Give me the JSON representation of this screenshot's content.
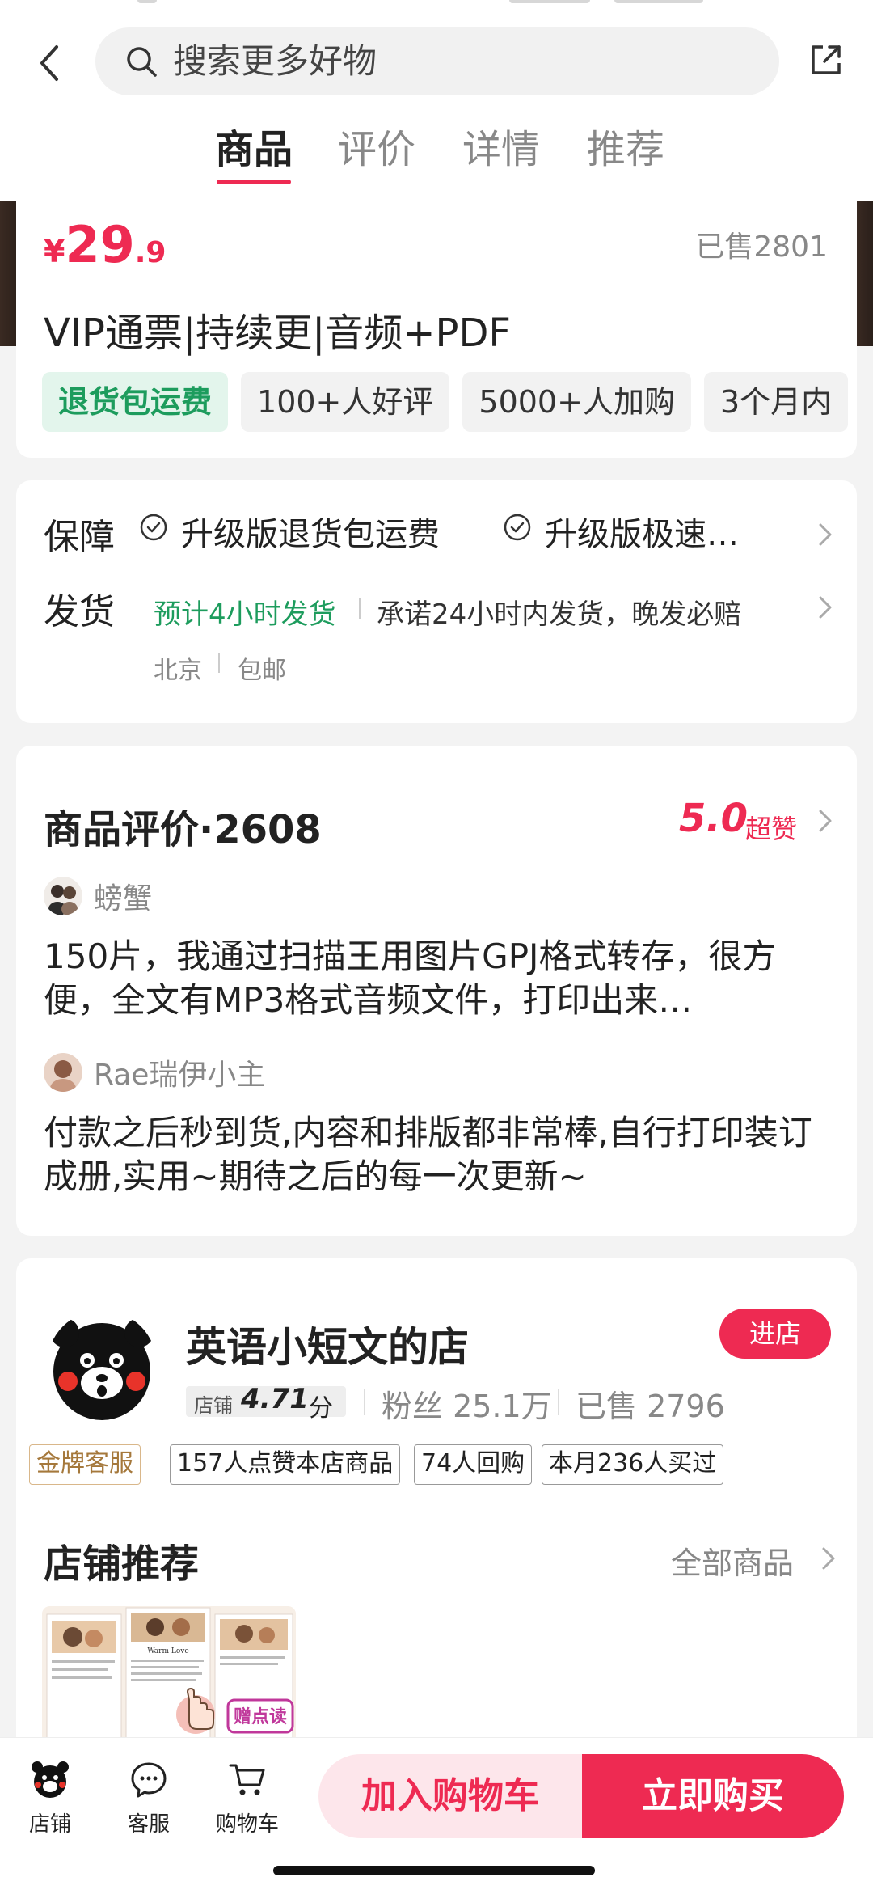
{
  "search": {
    "placeholder": "搜索更多好物"
  },
  "tabs": [
    {
      "label": "商品",
      "active": true
    },
    {
      "label": "评价",
      "active": false
    },
    {
      "label": "详情",
      "active": false
    },
    {
      "label": "推荐",
      "active": false
    }
  ],
  "product": {
    "currency": "¥",
    "price_int": "29",
    "price_dec": ".9",
    "sold": "已售2801",
    "title": "VIP通票|持续更|音频+PDF",
    "tags": [
      "退货包运费",
      "100+人好评",
      "5000+人加购",
      "3个月内"
    ]
  },
  "guarantee": {
    "label": "保障",
    "items": [
      "升级版退货包运费",
      "升级版极速…"
    ]
  },
  "shipping": {
    "label": "发货",
    "estimate": "预计4小时发货",
    "promise": "承诺24小时内发货，晚发必赔",
    "origin": "北京",
    "postage": "包邮"
  },
  "reviews": {
    "title": "商品评价·2608",
    "score": "5.0",
    "score_label": "超赞",
    "items": [
      {
        "user": "螃蟹",
        "text": "150片，我通过扫描王用图片GPJ格式转存，很方便，全文有MP3格式音频文件，打印出来…"
      },
      {
        "user": "Rae瑞伊小主",
        "text": "付款之后秒到货,内容和排版都非常棒,自行打印装订成册,实用~期待之后的每一次更新~"
      }
    ]
  },
  "shop": {
    "name": "英语小短文的店",
    "enter_label": "进店",
    "rating_label": "店铺",
    "rating": "4.71",
    "rating_unit": "分",
    "fans": "粉丝 25.1万",
    "sold": "已售 2796",
    "badges": [
      "金牌客服",
      "157人点赞本店商品",
      "74人回购",
      "本月236人买过"
    ],
    "recommend_title": "店铺推荐",
    "all_products": "全部商品",
    "thumb_badge": "赠点读",
    "thumb_heading": "Warm Love"
  },
  "bottom": {
    "shop_label": "店铺",
    "service_label": "客服",
    "cart_label": "购物车",
    "add_cart": "加入购物车",
    "buy_now": "立即购买"
  },
  "colors": {
    "accent": "#ee2a52",
    "green": "#1d9c5d",
    "gold": "#a5783b"
  }
}
